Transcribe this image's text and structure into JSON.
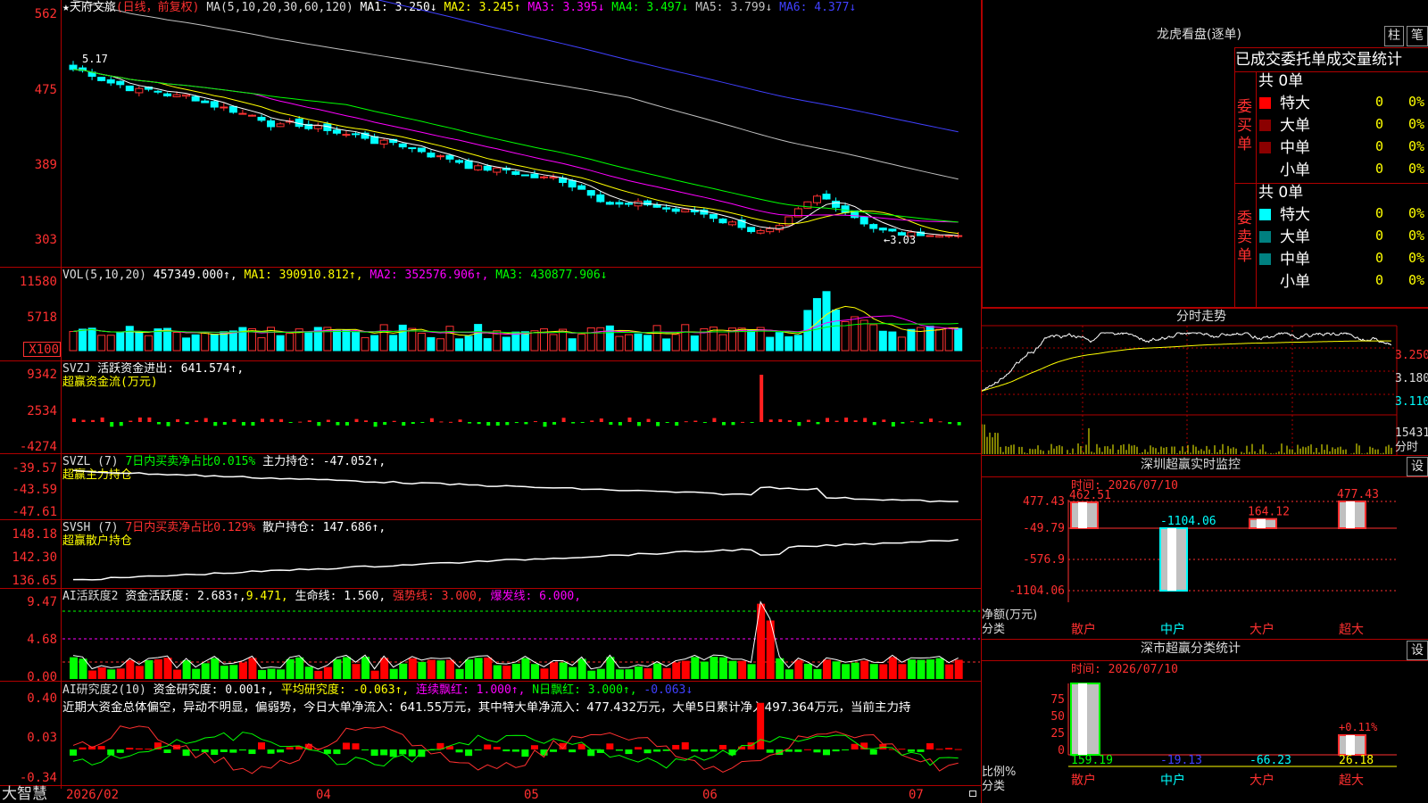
{
  "main": {
    "title": "★天府文旅",
    "period": "(日线，前复权)",
    "ma_label": "MA(5,10,20,30,60,120)",
    "ma1": "MA1: 3.250↓",
    "ma2": "MA2: 3.245↑",
    "ma3": "MA3: 3.395↓",
    "ma4": "MA4: 3.497↓",
    "ma5": "MA5: 3.799↓",
    "ma6": "MA6: 4.377↓",
    "yticks": [
      "562",
      "475",
      "389",
      "303"
    ],
    "high_mark": "5.17",
    "low_mark": "←3.03",
    "colors": {
      "ma1": "#ffffff",
      "ma2": "#ffff00",
      "ma3": "#ff00ff",
      "ma4": "#00ff00",
      "ma5": "#c0c0c0",
      "ma6": "#4040ff",
      "up": "#ff3232",
      "down": "#00ffff"
    }
  },
  "vol": {
    "label": "VOL(5,10,20)",
    "value": "457349.000↑,",
    "ma1": "MA1: 390910.812↑,",
    "ma2": "MA2: 352576.906↑,",
    "ma3": "MA3: 430877.906↓",
    "yticks": [
      "11580",
      "5718",
      "X100"
    ]
  },
  "svzj": {
    "label": "SVZJ",
    "text": "活跃资金进出: 641.574↑,",
    "sub": "超赢资金流(万元)",
    "yticks": [
      "9342",
      "2534",
      "-4274"
    ]
  },
  "svzl": {
    "label": "SVZL (7)",
    "ratio": "7日内买卖净占比0.015%",
    "text": "主力持仓: -47.052↑,",
    "sub": "超赢主力持仓",
    "yticks": [
      "-39.57",
      "-43.59",
      "-47.61"
    ]
  },
  "svsh": {
    "label": "SVSH (7)",
    "ratio": "7日内买卖净占比0.129%",
    "text": "散户持仓: 147.686↑,",
    "sub": "超赢散户持仓",
    "yticks": [
      "148.18",
      "142.30",
      "136.65"
    ]
  },
  "ai1": {
    "label": "AI活跃度2",
    "text": "资金活跃度: 2.683↑,",
    "v2": "9.471,",
    "life": "生命线: 1.560,",
    "strong": "强势线: 3.000,",
    "burst": "爆发线: 6.000,",
    "yticks": [
      "9.47",
      "4.68",
      "0.00"
    ]
  },
  "ai2": {
    "label": "AI研究度2(10)",
    "text": "资金研究度: 0.001↑,",
    "avg": "平均研究度: -0.063↑,",
    "red": "连续飘红: 1.000↑,",
    "nred": "N日飘红: 3.000↑,",
    "last": "-0.063↓",
    "comment": "近期大资金总体偏空，异动不明显，偏弱势，今日大单净流入：641.55万元，其中特大单净流入：477.432万元，大单5日累计净入497.364万元，当前主力持",
    "yticks": [
      "0.40",
      "0.03",
      "-0.34"
    ]
  },
  "xaxis": {
    "brand": "大智慧",
    "labels": [
      "2026/02",
      "04",
      "05",
      "06",
      "07"
    ]
  },
  "right": {
    "lhb_title": "龙虎看盘(逐单)",
    "btn1": "柱",
    "btn2": "笔",
    "stat_title": "已成交委托单成交量统计",
    "buy_group": "委买单",
    "sell_group": "委卖单",
    "total": "共 0单",
    "rows": [
      {
        "name": "特大",
        "val": "0",
        "pct": "0%"
      },
      {
        "name": "大单",
        "val": "0",
        "pct": "0%"
      },
      {
        "name": "中单",
        "val": "0",
        "pct": "0%"
      },
      {
        "name": "小单",
        "val": "0",
        "pct": "0%"
      }
    ],
    "fs_title": "分时走势",
    "fs_yticks": [
      "3.250",
      "3.180",
      "3.110"
    ],
    "fs_vol": "15431",
    "fs_vol2": "分时",
    "sz_title": "深圳超赢实时监控",
    "set": "设",
    "time1": "时间: 2026/07/10",
    "sz_yticks": [
      "477.43",
      "-49.79",
      "-576.9",
      "-1104.06"
    ],
    "sz_vals": [
      "462.51",
      "-1104.06",
      "164.12",
      "477.43"
    ],
    "sz_unit": "净额(万元)",
    "sz_cat": "分类",
    "cats": [
      "散户",
      "中户",
      "大户",
      "超大"
    ],
    "fl_title": "深市超赢分类统计",
    "time2": "时间: 2026/07/10",
    "fl_yticks": [
      "75",
      "50",
      "25",
      "0"
    ],
    "fl_pct": "+0.11%",
    "fl_vals": [
      "159.19",
      "-19.13",
      "-66.23",
      "26.18"
    ],
    "fl_unit": "比例%",
    "fl_cat": "分类"
  }
}
